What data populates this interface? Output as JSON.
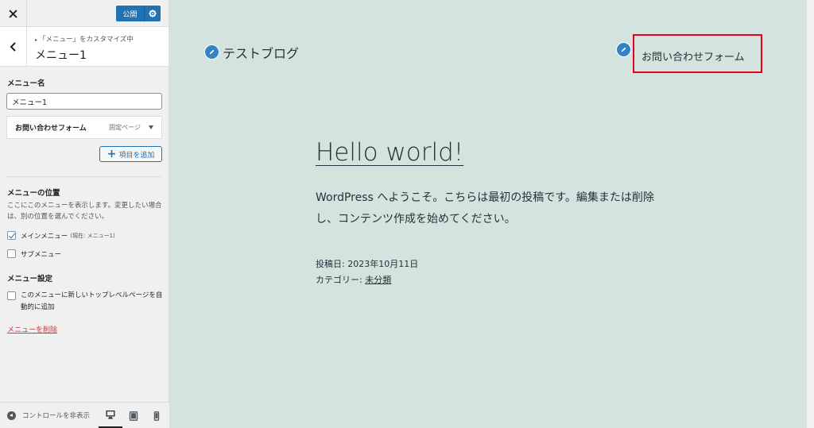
{
  "topbar": {
    "publish_label": "公開"
  },
  "section": {
    "breadcrumb": "「メニュー」をカスタマイズ中",
    "title": "メニュー1"
  },
  "menu_name": {
    "label": "メニュー名",
    "value": "メニュー1"
  },
  "menu_items": [
    {
      "title": "お問い合わせフォーム",
      "type": "固定ページ"
    }
  ],
  "add_items_label": "項目を追加",
  "locations": {
    "heading": "メニューの位置",
    "description": "ここにこのメニューを表示します。変更したい場合は、別の位置を選んでください。",
    "options": [
      {
        "label": "メインメニュー",
        "note": "(現在: メニュー1)",
        "checked": true
      },
      {
        "label": "サブメニュー",
        "note": "",
        "checked": false
      }
    ]
  },
  "settings": {
    "heading": "メニュー設定",
    "auto_add_label": "このメニューに新しいトップレベルページを自動的に追加",
    "auto_add_checked": false
  },
  "delete_label": "メニューを削除",
  "footer": {
    "hide_controls_label": "コントロールを非表示"
  },
  "preview": {
    "site_title": "テストブログ",
    "nav_item": "お問い合わせフォーム",
    "post_title": "Hello world!",
    "post_body": "WordPress へようこそ。こちらは最初の投稿です。編集または削除し、コンテンツ作成を始めてください。",
    "posted_on_label": "投稿日:",
    "posted_on_value": "2023年10月11日",
    "category_label": "カテゴリー:",
    "category_value": "未分類",
    "highlight_color": "#e2001a",
    "background_color": "#d4e3dd"
  },
  "colors": {
    "accent": "#2271b1",
    "danger": "#d63638",
    "shortcut": "#3582c4"
  }
}
